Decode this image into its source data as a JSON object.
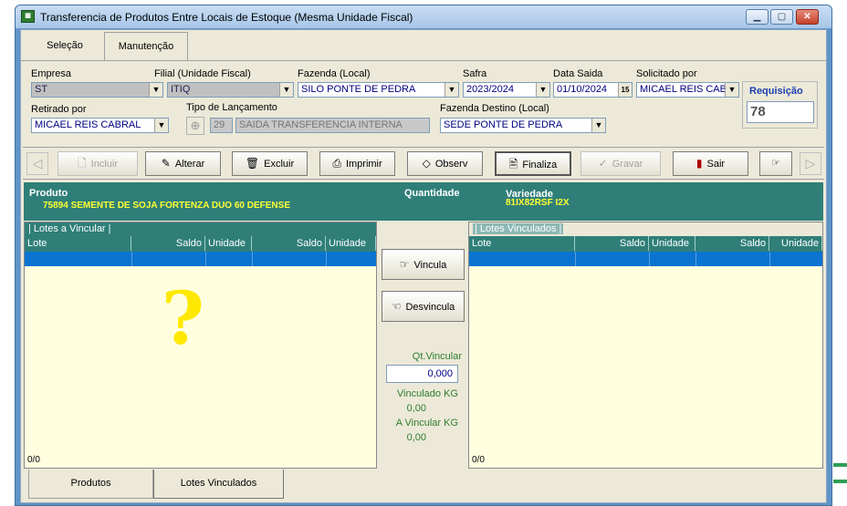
{
  "window": {
    "title": "Transferencia de Produtos Entre Locais de Estoque (Mesma Unidade Fiscal)",
    "icon": "app-grid-icon"
  },
  "tabs": [
    {
      "label": "Seleção"
    },
    {
      "label": "Manutenção"
    }
  ],
  "form": {
    "empresa": {
      "label": "Empresa",
      "value": "ST"
    },
    "filial": {
      "label": "Filial (Unidade Fiscal)",
      "value": "ITIQ"
    },
    "fazenda": {
      "label": "Fazenda (Local)",
      "value": "SILO PONTE DE PEDRA"
    },
    "safra": {
      "label": "Safra",
      "value": "2023/2024"
    },
    "data_saida": {
      "label": "Data Saida",
      "value": "01/10/2024",
      "calendar_day": "15"
    },
    "solicitado": {
      "label": "Solicitado por",
      "value": "MICAEL REIS CABR"
    },
    "requisicao": {
      "label": "Requisição",
      "value": "78"
    },
    "retirado": {
      "label": "Retirado por",
      "value": "MICAEL REIS CABRAL"
    },
    "tipo": {
      "label": "Tipo de Lançamento",
      "code": "29",
      "value": "SAIDA TRANSFERENCIA INTERNA"
    },
    "destino": {
      "label": "Fazenda Destino  (Local)",
      "value": "SEDE PONTE DE PEDRA"
    }
  },
  "toolbar": {
    "incluir": "Incluir",
    "alterar": "Alterar",
    "excluir": "Excluir",
    "imprimir": "Imprimir",
    "observ": "Observ",
    "finaliza": "Finaliza",
    "gravar": "Gravar",
    "sair": "Sair"
  },
  "product": {
    "produto_label": "Produto",
    "produto_value": "75894 SEMENTE DE SOJA FORTENZA DUO 60 DEFENSE",
    "quantidade_label": "Quantidade",
    "variedade_label": "Variedade",
    "variedade_value": "81IX82RSF I2X"
  },
  "left_grid": {
    "title": "| Lotes a Vincular |",
    "columns": [
      "Lote",
      "Saldo",
      "Unidade",
      "Saldo",
      "Unidade"
    ],
    "footer": "0/0",
    "annotation": "?"
  },
  "right_grid": {
    "title": "| Lotes Vinculados |",
    "columns": [
      "Lote",
      "Saldo",
      "Unidade",
      "Saldo",
      "Unidade"
    ],
    "footer": "0/0"
  },
  "middle": {
    "vincula": "Vincula",
    "desvincula": "Desvincula",
    "qt_label": "Qt.Vincular",
    "qt_value": "0,000",
    "vinculado_label": "Vinculado KG",
    "vinculado_value": "0,00",
    "avincular_label": "A Vincular KG",
    "avincular_value": "0,00"
  },
  "bottom_tabs": [
    {
      "label": "Produtos"
    },
    {
      "label": "Lotes Vinculados"
    }
  ],
  "colors": {
    "teal": "#2f7f78",
    "grid_bg": "#ffffe0",
    "selection": "#0a74d0",
    "highlight_yellow": "#ffff33"
  }
}
